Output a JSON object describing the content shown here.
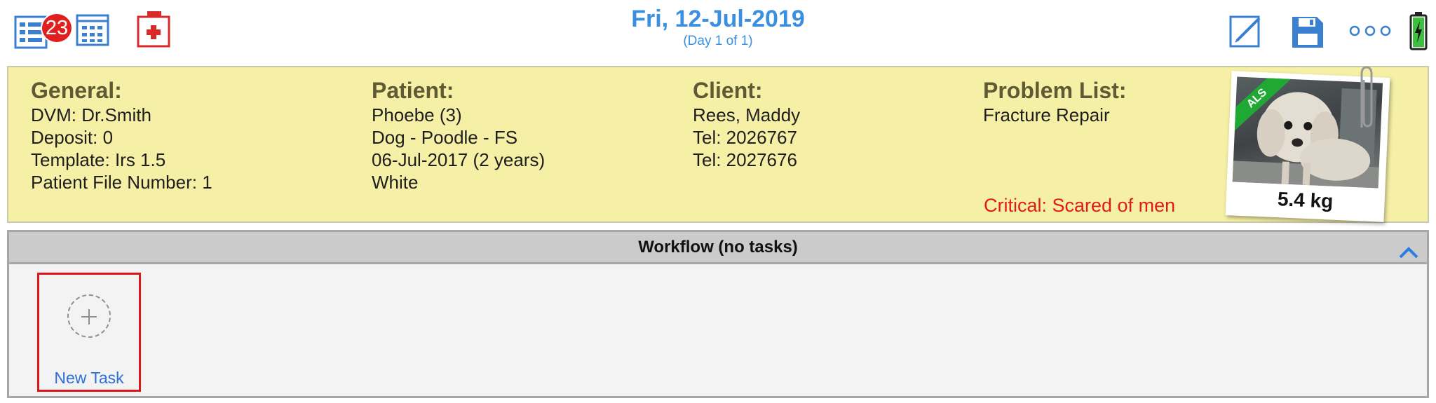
{
  "header": {
    "badge_count": "23",
    "date_title": "Fri, 12-Jul-2019",
    "day_subtitle": "(Day 1 of 1)",
    "accent_color": "#3b8fe0"
  },
  "icons": {
    "left": [
      "task-list-icon",
      "calendar-grid-icon",
      "medical-kit-icon"
    ],
    "right": [
      "edit-note-icon",
      "save-icon",
      "more-icon",
      "battery-icon"
    ]
  },
  "card": {
    "general": {
      "heading": "General:",
      "lines": [
        "DVM: Dr.Smith",
        "Deposit: 0",
        "Template: Irs 1.5",
        "Patient File Number: 1"
      ]
    },
    "patient": {
      "heading": "Patient:",
      "lines": [
        "Phoebe (3)",
        "Dog - Poodle - FS",
        "06-Jul-2017 (2 years)",
        "White"
      ]
    },
    "client": {
      "heading": "Client:",
      "lines": [
        "Rees, Maddy",
        "Tel: 2026767",
        "Tel: 2027676"
      ]
    },
    "problem_list": {
      "heading": "Problem List:",
      "lines": [
        "Fracture Repair"
      ]
    },
    "critical_note": "Critical: Scared of men",
    "photo_tag": "ALS",
    "weight": "5.4 kg",
    "background_color": "#f6f0a6",
    "critical_color": "#e01b1b"
  },
  "workflow": {
    "title": "Workflow (no tasks)",
    "new_task_label": "New Task"
  }
}
